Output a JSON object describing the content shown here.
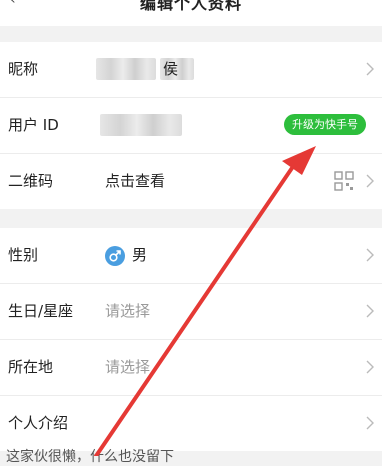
{
  "header": {
    "title": "编辑个人资料",
    "back_glyph": "‹",
    "more_glyph": "···"
  },
  "profile": {
    "nickname_label": "昵称",
    "nickname_value_visible": "侯",
    "user_id_label": "用户 ID",
    "upgrade_badge": "升级为快手号",
    "qr_label": "二维码",
    "qr_link": "点击查看"
  },
  "details": {
    "gender_label": "性别",
    "gender_value": "男",
    "birthday_label": "生日/星座",
    "birthday_placeholder": "请选择",
    "location_label": "所在地",
    "location_placeholder": "请选择",
    "intro_label": "个人介绍"
  },
  "footer": {
    "partial_text": "这家伙很懒，什么也没留下"
  },
  "colors": {
    "accent_green": "#2dbe3c",
    "annotation_arrow": "#e53935",
    "gender_blue": "#4a9ee0",
    "link_blue": "#2f5f8f"
  },
  "icons": [
    "chevron-right-icon",
    "qr-code-icon",
    "male-icon",
    "annotation-arrow"
  ]
}
